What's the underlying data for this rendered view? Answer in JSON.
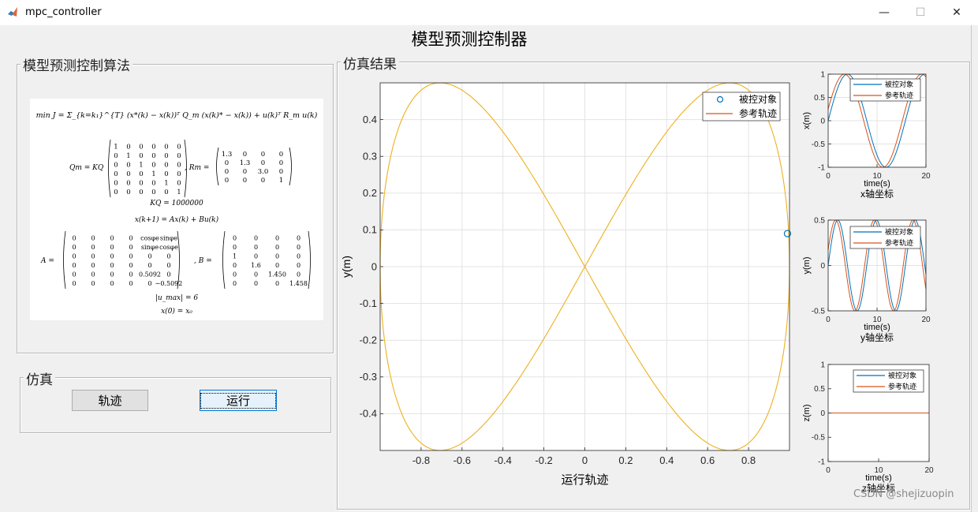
{
  "window": {
    "title": "mpc_controller",
    "controls": {
      "minimize": "—",
      "maximize": "☐",
      "close": "✕"
    }
  },
  "figure_title": "模型预测控制器",
  "algorithm_panel": {
    "title": "模型预测控制算法",
    "equations": {
      "objective": "min J = Σ_{k=k₁}^{T} (x*(k) − x(k))ᵀ Q_m (x(k)* − x(k)) + u(k)ᵀ R_m u(k)",
      "q_label": "Qm = KQ",
      "q_rows": [
        [
          "1",
          "0",
          "0",
          "0",
          "0",
          "0"
        ],
        [
          "0",
          "1",
          "0",
          "0",
          "0",
          "0"
        ],
        [
          "0",
          "0",
          "1",
          "0",
          "0",
          "0"
        ],
        [
          "0",
          "0",
          "0",
          "1",
          "0",
          "0"
        ],
        [
          "0",
          "0",
          "0",
          "0",
          "1",
          "0"
        ],
        [
          "0",
          "0",
          "0",
          "0",
          "0",
          "1"
        ]
      ],
      "r_label": ", Rm =",
      "r_rows": [
        [
          "1.3",
          "0",
          "0",
          "0"
        ],
        [
          "0",
          "1.3",
          "0",
          "0"
        ],
        [
          "0",
          "0",
          "3.0",
          "0"
        ],
        [
          "0",
          "0",
          "0",
          "1"
        ]
      ],
      "kq": "KQ = 1000000",
      "dynamics": "x(k+1) = Ax(k) + Bu(k)",
      "a_label": "A =",
      "a_rows": [
        [
          "0",
          "0",
          "0",
          "0",
          "cosφe",
          "sinφe"
        ],
        [
          "0",
          "0",
          "0",
          "0",
          "sinφe",
          "cosφe"
        ],
        [
          "0",
          "0",
          "0",
          "0",
          "0",
          "0"
        ],
        [
          "0",
          "0",
          "0",
          "0",
          "0",
          "0"
        ],
        [
          "0",
          "0",
          "0",
          "0",
          "0.5092",
          "0"
        ],
        [
          "0",
          "0",
          "0",
          "0",
          "0",
          "−0.5092"
        ]
      ],
      "b_label": ", B =",
      "b_rows": [
        [
          "0",
          "0",
          "0",
          "0"
        ],
        [
          "0",
          "0",
          "0",
          "0"
        ],
        [
          "1",
          "0",
          "0",
          "0"
        ],
        [
          "0",
          "1.6",
          "0",
          "0"
        ],
        [
          "0",
          "0",
          "1.450",
          "0"
        ],
        [
          "0",
          "0",
          "0",
          "1.458"
        ]
      ],
      "constraint": "|u_max| = 6",
      "initial": "x(0) = x₀"
    }
  },
  "sim_panel": {
    "title": "仿真",
    "trajectory_button": "轨迹",
    "run_button": "运行"
  },
  "results_panel": {
    "title": "仿真结果"
  },
  "watermark": "CSDN @shejizuopin",
  "colors": {
    "blue": "#0072bd",
    "orange": "#d95319",
    "yellow": "#edb120"
  },
  "chart_data": [
    {
      "type": "line",
      "id": "main",
      "xlabel": "运行轨迹",
      "ylabel": "y(m)",
      "xlim": [
        -1,
        1
      ],
      "ylim": [
        -0.5,
        0.5
      ],
      "xticks": [
        "-0.8",
        "-0.6",
        "-0.4",
        "-0.2",
        "0",
        "0.2",
        "0.4",
        "0.6",
        "0.8"
      ],
      "yticks": [
        "0.4",
        "0.3",
        "0.2",
        "0.1",
        "0",
        "-0.1",
        "-0.2",
        "-0.3",
        "-0.4"
      ],
      "grid": true,
      "legend": {
        "placement": "top-right",
        "entries": [
          "被控对象",
          "参考轨迹"
        ]
      },
      "series": [
        {
          "name": "参考轨迹",
          "curve": "x = sin(t), y = sin(2t)/2, t ∈ [0, 2π]"
        }
      ],
      "marker_point": {
        "series": "被控对象",
        "x": 0.99,
        "y": 0.09
      }
    },
    {
      "type": "line",
      "id": "x",
      "title": "x轴坐标",
      "xlabel": "time(s)",
      "ylabel": "x(m)",
      "xlim": [
        0,
        20
      ],
      "ylim": [
        -1,
        1
      ],
      "xticks": [
        "0",
        "10",
        "20"
      ],
      "yticks": [
        "1",
        "0.5",
        "0",
        "-0.5",
        "-1"
      ],
      "grid": true,
      "legend": {
        "placement": "top-right",
        "entries": [
          "被控对象",
          "参考轨迹"
        ]
      }
    },
    {
      "type": "line",
      "id": "y",
      "title": "y轴坐标",
      "xlabel": "time(s)",
      "ylabel": "y(m)",
      "xlim": [
        0,
        20
      ],
      "ylim": [
        -0.5,
        0.5
      ],
      "xticks": [
        "0",
        "10",
        "20"
      ],
      "yticks": [
        "0.5",
        "0",
        "-0.5"
      ],
      "grid": true,
      "legend": {
        "placement": "top-right",
        "entries": [
          "被控对象",
          "参考轨迹"
        ]
      }
    },
    {
      "type": "line",
      "id": "z",
      "title": "z轴坐标",
      "xlabel": "time(s)",
      "ylabel": "z(m)",
      "xlim": [
        0,
        20
      ],
      "ylim": [
        -1,
        1
      ],
      "xticks": [
        "0",
        "10",
        "20"
      ],
      "yticks": [
        "1",
        "0.5",
        "0",
        "-0.5",
        "-1"
      ],
      "grid": false,
      "legend": {
        "placement": "top-right",
        "entries": [
          "被控对象",
          "参考轨迹"
        ]
      },
      "series": [
        {
          "name": "被控对象",
          "x": [
            0,
            20
          ],
          "y": [
            0,
            0
          ]
        },
        {
          "name": "参考轨迹",
          "x": [
            0,
            20
          ],
          "y": [
            0,
            0
          ]
        }
      ]
    }
  ]
}
